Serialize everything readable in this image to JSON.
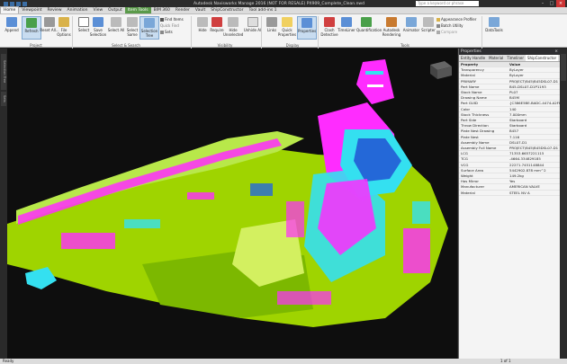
{
  "app": {
    "title": "Autodesk Navisworks Manage 2016 (NOT FOR RESALE)   PX909_Complete_Clean.nwd",
    "search_placeholder": "Type a keyword or phrase"
  },
  "tabs": [
    "Home",
    "Viewpoint",
    "Review",
    "Animation",
    "View",
    "Output",
    "Item Tools",
    "BIM 360",
    "Render",
    "Vault",
    "ShipConstructor",
    "Tool add-ins 1"
  ],
  "ribbon": {
    "buttons": [
      "Append",
      "Refresh",
      "Reset All...",
      "File Options",
      "Select",
      "Save Selection",
      "Select All",
      "Select Same",
      "Selection Tree",
      "Hide",
      "Require",
      "Hide Unselected",
      "Unhide All",
      "Links",
      "Quick Properties",
      "Properties",
      "Clash Detective",
      "TimeLiner",
      "Quantification",
      "Autodesk Rendering",
      "Animator",
      "Scripter",
      "DataTools"
    ],
    "small": {
      "find_items": "Find Items",
      "quick_find": "Quick Find",
      "sets": "Sets",
      "appearance_profiler": "Appearance Profiler",
      "batch_utility": "Batch Utility",
      "compare": "Compare"
    },
    "panels": [
      "Project",
      "Select & Search",
      "Visibility",
      "Display",
      "Tools"
    ]
  },
  "left_tabs": [
    "Selection Tree",
    "Sets"
  ],
  "properties": {
    "title": "Properties",
    "tabs": [
      "Entity Handle",
      "Material",
      "Timeliner",
      "ShipConstructor"
    ],
    "header": {
      "k": "Property",
      "v": "Value"
    },
    "rows": [
      {
        "k": "Transparency",
        "v": "ByLayer"
      },
      {
        "k": "Material",
        "v": "ByLayer"
      },
      {
        "k": "PRIMARY",
        "v": "PROJECT\\B45\\B45DSL07-D1"
      },
      {
        "k": "Part Name",
        "v": "B45-DSL07-D1P1193"
      },
      {
        "k": "Stock Name",
        "v": "PL07"
      },
      {
        "k": "Drawing Name",
        "v": "B45M"
      },
      {
        "k": "Part GUID",
        "v": "{C386E5BE-BADC-4474-A2FB..."
      },
      {
        "k": "Color",
        "v": "140"
      },
      {
        "k": "Stock Thickness",
        "v": "7.000mm"
      },
      {
        "k": "Part Side",
        "v": "Starboard"
      },
      {
        "k": "Throw Direction",
        "v": "Starboard"
      },
      {
        "k": "Plate Nest Drawing",
        "v": "B457"
      },
      {
        "k": "Plate Nest",
        "v": "7.116"
      },
      {
        "k": "Assembly Name",
        "v": "DSL07-D1"
      },
      {
        "k": "Assembly Full Name",
        "v": "PROJECT\\B45\\B45DSL07-D1"
      },
      {
        "k": "LCG",
        "v": "71353.6657221115"
      },
      {
        "k": "TCG",
        "v": "-4664.334829185"
      },
      {
        "k": "VCG",
        "v": "22271.7451148844"
      },
      {
        "k": "Surface Area",
        "v": "5442902.878 mm^2"
      },
      {
        "k": "Weight",
        "v": "149.2kg"
      },
      {
        "k": "Has Mirror",
        "v": "Yes"
      },
      {
        "k": "Manufacturer",
        "v": "AMERICAN VALVE"
      },
      {
        "k": "Material",
        "v": "STEEL NV A"
      }
    ]
  },
  "status": {
    "left": "Ready",
    "page": "1 of 1"
  },
  "colors": {
    "hull": "#9fd400",
    "magenta": "#ff2cff",
    "cyan": "#34e0f0",
    "selection_blue": "#3b6ea5"
  }
}
